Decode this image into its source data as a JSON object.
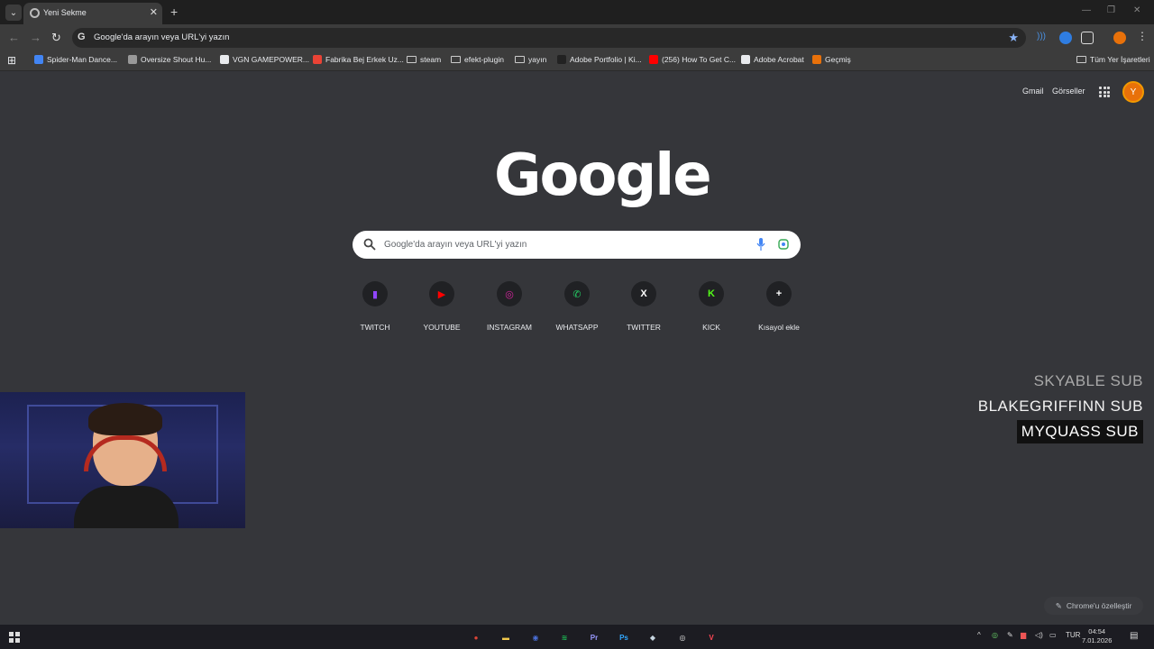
{
  "tab": {
    "title": "Yeni Sekme"
  },
  "omnibox": {
    "text": "Google'da arayın veya URL'yi yazın"
  },
  "profile": {
    "initial": "Y"
  },
  "bookmarks": [
    {
      "label": "Spider-Man Dance...",
      "color": "#4285f4"
    },
    {
      "label": "Oversize Shout Hu...",
      "color": "#999999"
    },
    {
      "label": "VGN GAMEPOWER...",
      "color": "#e8eaed"
    },
    {
      "label": "Fabrika Bej Erkek Uz...",
      "color": "#ea4335"
    },
    {
      "label": "steam",
      "folder": true
    },
    {
      "label": "efekt-plugin",
      "folder": true
    },
    {
      "label": "yayın",
      "folder": true
    },
    {
      "label": "Adobe Portfolio | Ki...",
      "color": "#222222"
    },
    {
      "label": "(256) How To Get C...",
      "color": "#ff0000"
    },
    {
      "label": "Adobe Acrobat",
      "color": "#e8eaed"
    },
    {
      "label": "Geçmiş",
      "color": "#e8710a"
    }
  ],
  "bookmarks_all": "Tüm Yer İşaretleri",
  "header": {
    "gmail": "Gmail",
    "images": "Görseller"
  },
  "logo": "Google",
  "search": {
    "placeholder": "Google'da arayın veya URL'yi yazın"
  },
  "shortcuts": [
    {
      "label": "TWITCH",
      "icon": "twitch-icon",
      "glyph": "▮",
      "color": "#9146ff"
    },
    {
      "label": "YOUTUBE",
      "icon": "youtube-icon",
      "glyph": "▶",
      "color": "#ff0000"
    },
    {
      "label": "INSTAGRAM",
      "icon": "instagram-icon",
      "glyph": "◎",
      "color": "#d6249f"
    },
    {
      "label": "WHATSAPP",
      "icon": "whatsapp-icon",
      "glyph": "✆",
      "color": "#25d366"
    },
    {
      "label": "TWITTER",
      "icon": "x-icon",
      "glyph": "X",
      "color": "#ffffff"
    },
    {
      "label": "KICK",
      "icon": "kick-icon",
      "glyph": "K",
      "color": "#53fc18"
    },
    {
      "label": "Kısayol ekle",
      "icon": "plus-icon",
      "glyph": "+",
      "color": "#ffffff"
    }
  ],
  "subs": [
    "SKYABLE  SUB",
    "BLAKEGRIFFINN  SUB",
    "MYQUASS  SUB"
  ],
  "customize": "Chrome'u özelleştir",
  "taskbar": {
    "lang": "TUR",
    "time": "04:54",
    "date": "7.01.2026",
    "apps": [
      {
        "name": "chrome-icon",
        "glyph": "●",
        "color": "#db4437"
      },
      {
        "name": "file-explorer-icon",
        "glyph": "▬",
        "color": "#f2c94c"
      },
      {
        "name": "browser-icon",
        "glyph": "◉",
        "color": "#4a6fd8"
      },
      {
        "name": "spotify-icon",
        "glyph": "≋",
        "color": "#1db954"
      },
      {
        "name": "premiere-icon",
        "glyph": "Pr",
        "color": "#9999ff"
      },
      {
        "name": "photoshop-icon",
        "glyph": "Ps",
        "color": "#31a8ff"
      },
      {
        "name": "steam-icon",
        "glyph": "◆",
        "color": "#c7d5e0"
      },
      {
        "name": "obs-icon",
        "glyph": "◎",
        "color": "#dddddd"
      },
      {
        "name": "valorant-icon",
        "glyph": "V",
        "color": "#ff4655"
      }
    ]
  }
}
